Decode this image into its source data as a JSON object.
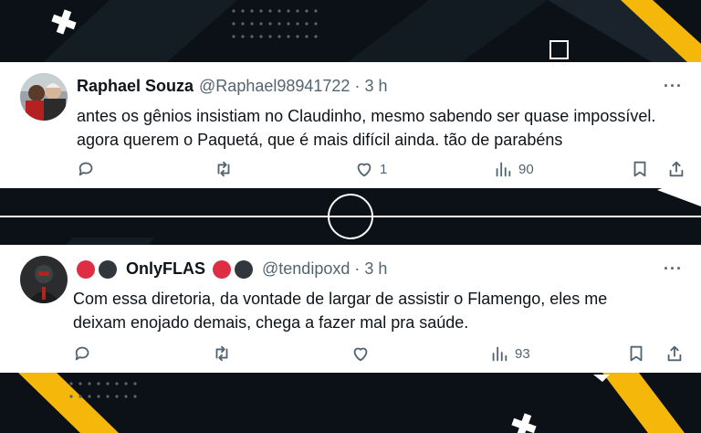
{
  "colors": {
    "page_background": "#0b1117",
    "accent_yellow": "#f5b70a",
    "card_background": "#ffffff",
    "text_primary": "#0f1419",
    "text_secondary": "#536471"
  },
  "tweets": [
    {
      "display_name": "Raphael Souza",
      "handle": "@Raphael98941722",
      "separator": "·",
      "time": "3 h",
      "text_lines": [
        "antes os gênios insistiam no Claudinho, mesmo sabendo ser quase impossível.",
        "agora querem o Paquetá, que é mais difícil ainda. tão de parabéns"
      ],
      "likes": "1",
      "views": "90"
    },
    {
      "display_name": "OnlyFLAS",
      "handle": "@tendipoxd",
      "separator": "·",
      "time": "3 h",
      "text_lines": [
        "Com essa diretoria, da vontade de largar de assistir o Flamengo, eles me",
        "deixam enojado demais, chega a fazer mal pra saúde."
      ],
      "likes": "",
      "views": "93"
    }
  ],
  "icons": {
    "more": "more-options-icon",
    "reply": "reply-icon",
    "retweet": "retweet-icon",
    "like": "like-icon",
    "views": "views-icon",
    "bookmark": "bookmark-icon",
    "share": "share-icon",
    "decor_plus": "plus-icon",
    "decor_square": "square-icon",
    "decor_circle": "center-circle-icon"
  },
  "more_glyph": "···"
}
